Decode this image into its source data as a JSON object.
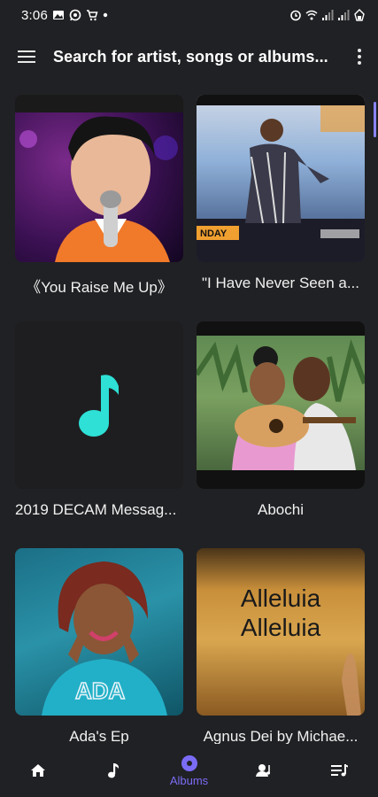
{
  "status_bar": {
    "time": "3:06",
    "left_icons": [
      "image-icon",
      "whatsapp-icon",
      "cart-icon",
      "dot-icon"
    ],
    "right_icons": [
      "alarm-icon",
      "wifi-icon",
      "signal-icon",
      "signal-icon",
      "battery-icon"
    ]
  },
  "top_bar": {
    "title": "Search for artist, songs or albums...",
    "menu_icon": "hamburger-menu-icon",
    "more_icon": "more-vert-icon"
  },
  "albums": [
    {
      "title": "《You Raise Me Up》",
      "cover": "photo-boy-singing"
    },
    {
      "title": "\"I Have Never Seen a...",
      "cover": "photo-preacher-stage"
    },
    {
      "title": "2019 DECAM Messag...",
      "cover": "music-note-placeholder"
    },
    {
      "title": "Abochi",
      "cover": "photo-couple-guitar"
    },
    {
      "title": "Ada's Ep",
      "cover": "photo-ada-artist"
    },
    {
      "title": "Agnus Dei by Michae...",
      "cover": "text-alleluia-parchment"
    }
  ],
  "cover_text": {
    "alleluia_line1": "Alleluia",
    "alleluia_line2": "Alleluia",
    "ada_logo": "ADA"
  },
  "bottom_nav": {
    "items": [
      {
        "icon": "home-icon",
        "label": ""
      },
      {
        "icon": "music-note-icon",
        "label": ""
      },
      {
        "icon": "album-icon",
        "label": "Albums",
        "active": true
      },
      {
        "icon": "artist-icon",
        "label": ""
      },
      {
        "icon": "playlist-icon",
        "label": ""
      }
    ]
  },
  "colors": {
    "background": "#202124",
    "accent": "#7b6cf6",
    "placeholder_note": "#2ee0d6"
  }
}
